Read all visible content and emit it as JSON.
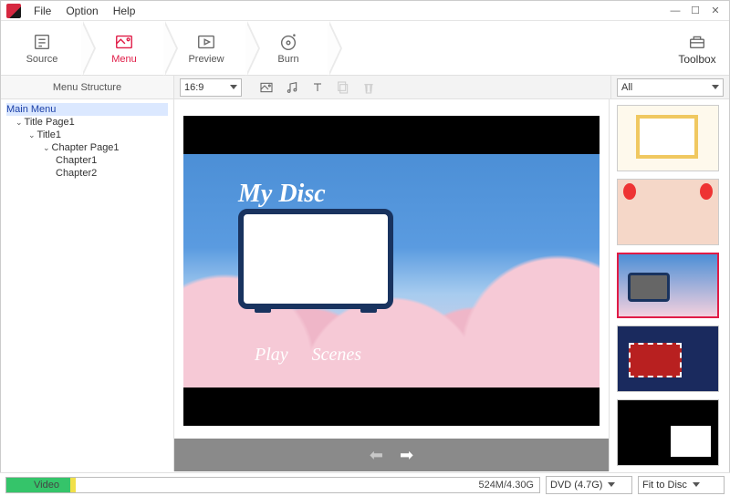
{
  "menubar": {
    "file": "File",
    "option": "Option",
    "help": "Help"
  },
  "toolbar": {
    "source": "Source",
    "menu": "Menu",
    "preview": "Preview",
    "burn": "Burn",
    "toolbox": "Toolbox"
  },
  "options": {
    "structureTitle": "Menu Structure",
    "aspect": "16:9",
    "filter": "All"
  },
  "tree": {
    "main": "Main Menu",
    "titlePage": "Title Page1",
    "title": "Title1",
    "chapterPage": "Chapter Page1",
    "ch1": "Chapter1",
    "ch2": "Chapter2"
  },
  "disc": {
    "title": "My Disc",
    "play": "Play",
    "scenes": "Scenes"
  },
  "status": {
    "label": "Video",
    "size": "524M/4.30G",
    "disc": "DVD (4.7G)",
    "fit": "Fit to Disc"
  }
}
